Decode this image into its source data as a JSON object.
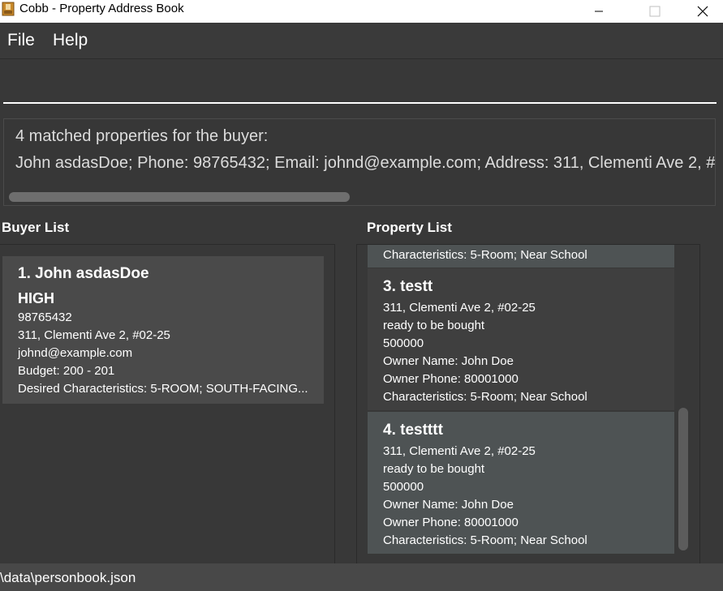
{
  "window": {
    "title": "Cobb - Property Address Book",
    "app_icon": "cobb-app-icon",
    "controls": [
      "minimize-icon",
      "maximize-icon",
      "close-icon"
    ]
  },
  "menu": {
    "file": "File",
    "help": "Help"
  },
  "command_box": {
    "value": "",
    "placeholder": ""
  },
  "result": {
    "line1": "4 matched properties for the buyer:",
    "line2": "John asdasDoe; Phone: 98765432; Email: johnd@example.com; Address: 311, Clementi Ave 2, #"
  },
  "buyer_list": {
    "title": "Buyer List",
    "buyers": [
      {
        "index_name": "1.  John asdasDoe",
        "priority": "HIGH",
        "phone": "98765432",
        "address": "311, Clementi Ave 2, #02-25",
        "email": "johnd@example.com",
        "budget": "Budget: 200 - 201",
        "characteristics": "Desired Characteristics: 5-ROOM; SOUTH-FACING..."
      }
    ]
  },
  "property_list": {
    "title": "Property List",
    "partial_line": "Characteristics: 5-Room; Near School",
    "properties": [
      {
        "index_name": "3.  testt",
        "address": "311, Clementi Ave 2, #02-25",
        "status": "ready to be bought",
        "price": "500000",
        "owner_name": "Owner Name: John Doe",
        "owner_phone": "Owner Phone: 80001000",
        "characteristics": "Characteristics: 5-Room; Near School"
      },
      {
        "index_name": "4.  testttt",
        "address": "311, Clementi Ave 2, #02-25",
        "status": "ready to be bought",
        "price": "500000",
        "owner_name": "Owner Name: John Doe",
        "owner_phone": "Owner Phone: 80001000",
        "characteristics": "Characteristics: 5-Room; Near School"
      }
    ]
  },
  "status_bar": {
    "path": "\\data\\personbook.json"
  }
}
